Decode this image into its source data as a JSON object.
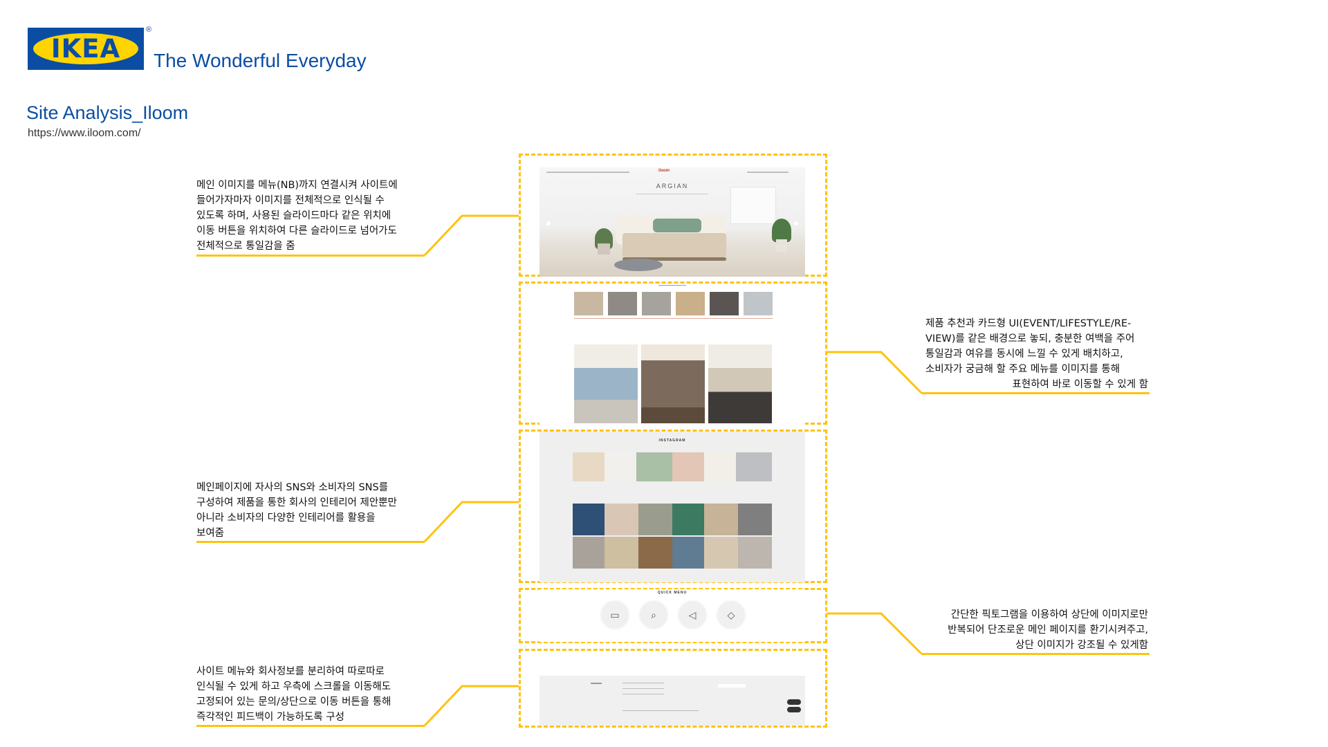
{
  "brand": {
    "logo_text": "IKEA",
    "registered": "®",
    "tagline": "The Wonderful Everyday",
    "colors": {
      "blue": "#0a4da3",
      "yellow": "#ffd400",
      "accent": "#ffc20e"
    }
  },
  "page": {
    "title": "Site Analysis_Iloom",
    "url": "https://www.iloom.com/"
  },
  "screens": {
    "hero": {
      "logo": "iloom",
      "headline": "ARGIAN"
    },
    "instagram": {
      "title": "INSTAGRAM"
    },
    "quick_menu": {
      "title": "QUICK MENU",
      "icons": [
        "store-icon",
        "search-doc-icon",
        "speaker-icon",
        "tag-icon"
      ]
    }
  },
  "annotations": [
    {
      "lines": [
        "메인 이미지를 메뉴(NB)까지 연결시켜 사이트에",
        "들어가자마자 이미지를 전체적으로 인식될 수",
        "있도록 하며, 사용된 슬라이드마다 같은 위치에",
        "이동 버튼을 위치하여 다른 슬라이드로 넘어가도",
        "전체적으로 통일감을 줌"
      ]
    },
    {
      "lines": [
        "제품 추천과 카드형 UI(EVENT/LIFESTYLE/RE-",
        "VIEW)를 같은 배경으로 놓되, 충분한 여백을 주어",
        "통일감과 여유를 동시에 느낄 수 있게 배치하고,",
        "소비자가 궁금해 할 주요 메뉴를 이미지를 통해",
        "표현하여 바로 이동할 수 있게 함"
      ]
    },
    {
      "lines": [
        "메인페이지에 자사의 SNS와 소비자의 SNS를",
        "구성하여 제품을 통한 회사의 인테리어 제안뿐만",
        "아니라 소비자의 다양한 인테리어를 활용을",
        "보여줌"
      ]
    },
    {
      "lines": [
        "간단한 픽토그램을 이용하여 상단에 이미지로만",
        "반복되어 단조로운 메인 페이지를 환기시켜주고,",
        "상단 이미지가 강조될 수 있게함"
      ]
    },
    {
      "lines": [
        "사이트 메뉴와 회사정보를 분리하여 따로따로",
        "인식될 수 있게 하고 우측에 스크롤을 이동해도",
        "고정되어 있는 문의/상단으로 이동 버튼을 통해",
        "즉각적인 피드백이 가능하도록 구성"
      ]
    }
  ]
}
